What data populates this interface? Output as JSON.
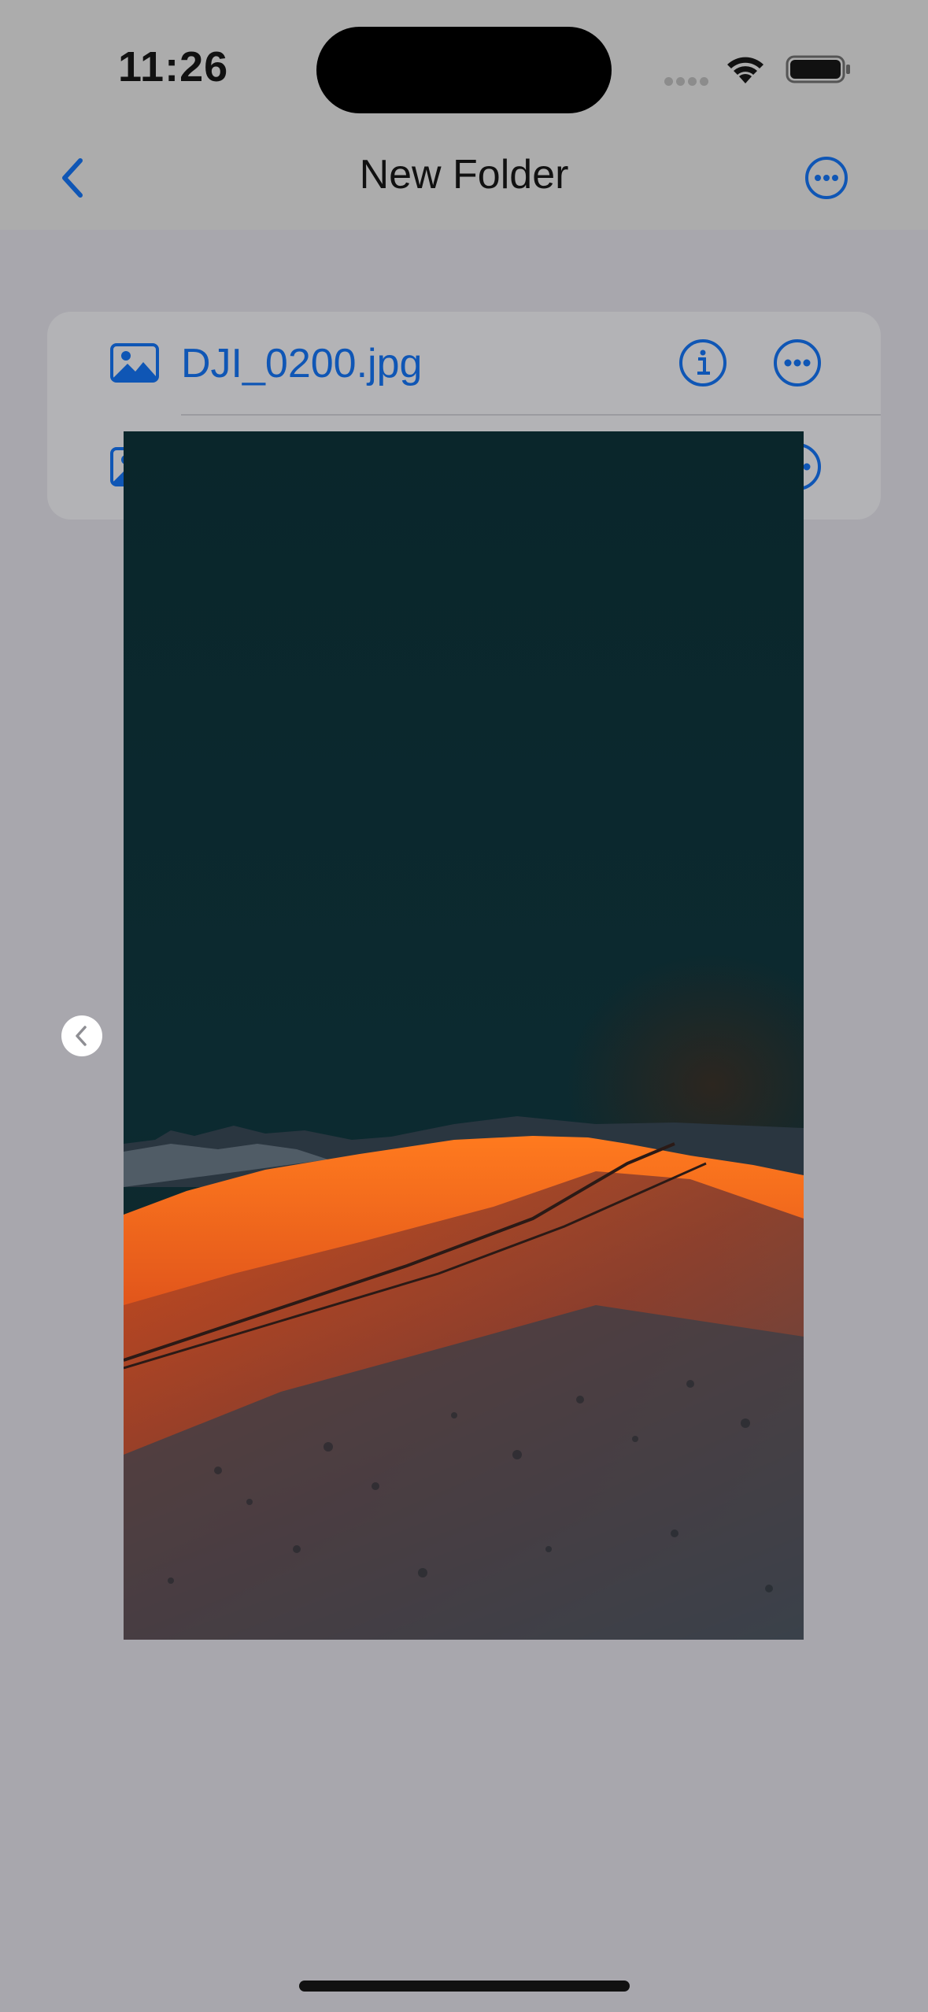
{
  "status_bar": {
    "time": "11:26"
  },
  "nav": {
    "title": "New Folder",
    "back_icon": "chevron-left-icon",
    "more_icon": "ellipsis-circle-icon"
  },
  "files": [
    {
      "name": "DJI_0200.jpg",
      "icon": "photo-icon"
    },
    {
      "name": "",
      "icon": "photo-icon"
    }
  ],
  "preview": {
    "description_icon": "photo-preview",
    "prev_icon": "chevron-left-icon"
  },
  "colors": {
    "accent": "#0f56b5",
    "background": "#a8a7ad"
  }
}
